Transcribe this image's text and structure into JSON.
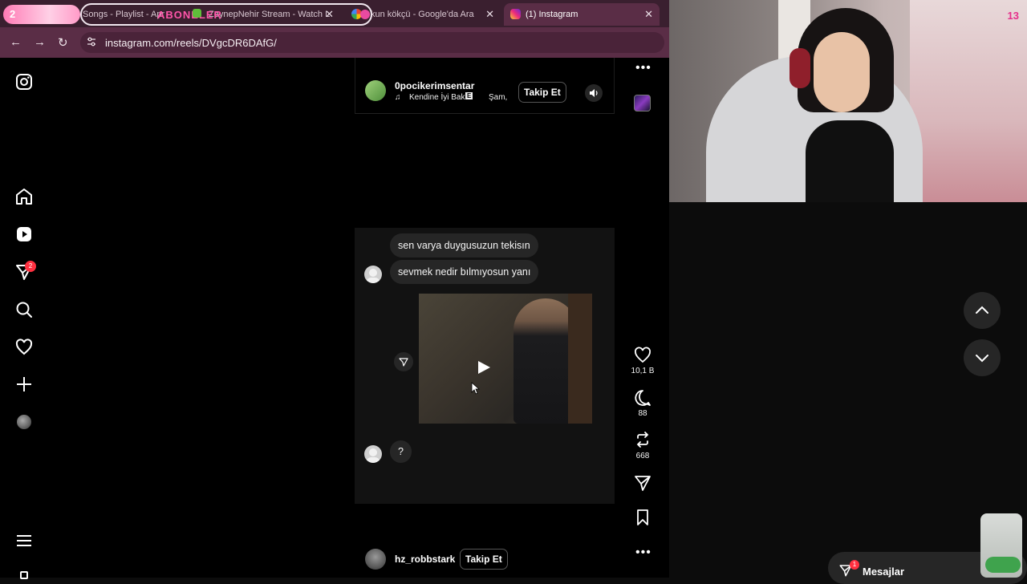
{
  "tabs": [
    {
      "label": "Songs - Playlist - Apr",
      "active": false
    },
    {
      "label": "ZeynepNehir Stream - Watch L",
      "active": false
    },
    {
      "label": "kun kökçü - Google'da Ara",
      "active": false
    },
    {
      "label": "(1) Instagram",
      "active": true
    }
  ],
  "overlay": {
    "counter": "2",
    "label": "ABONELER",
    "webcam_counter": "13"
  },
  "address": {
    "url": "instagram.com/reels/DVgcDR6DAfG/"
  },
  "sidebar": {
    "notification_badge": "2"
  },
  "reel_top": {
    "username": "0pocikerimsentar",
    "music": "Kendine İyi Bak",
    "explicit": "E",
    "music_artist": "Şam,",
    "follow_label": "Takip Et"
  },
  "messages": [
    {
      "text": "sen varya duygusuzun tekisın"
    },
    {
      "text": "sevmek nedir bılmıyosun yanı"
    },
    {
      "text": "?"
    }
  ],
  "actions": {
    "likes": "10,1 B",
    "comments": "88",
    "reposts": "668"
  },
  "reel_bottom": {
    "username": "hz_robbstark",
    "follow_label": "Takip Et"
  },
  "messages_bar": {
    "label": "Mesajlar",
    "badge": "1"
  },
  "colors": {
    "tab_bar": "#3a1f2f",
    "address_bar": "#5a2d46",
    "badge_red": "#ff3040",
    "overlay_pink": "#ff55aa"
  }
}
